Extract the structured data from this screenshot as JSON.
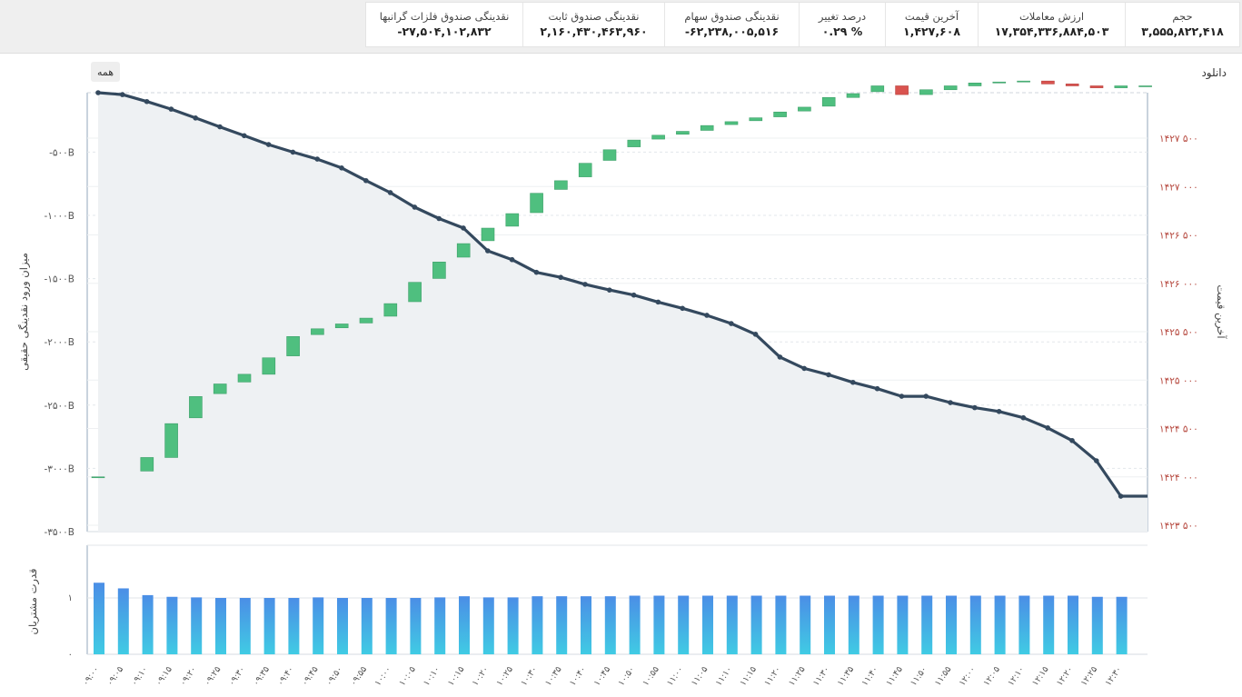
{
  "stats": [
    {
      "label": "حجم",
      "value": "۳,۵۵۵,۸۲۲,۴۱۸"
    },
    {
      "label": "ارزش معاملات",
      "value": "۱۷,۳۵۴,۳۳۶,۸۸۴,۵۰۳"
    },
    {
      "label": "آخرین قیمت",
      "value": "۱,۴۲۷,۶۰۸"
    },
    {
      "label": "درصد تغییر",
      "value": "۰.۲۹ %"
    },
    {
      "label": "نقدینگی صندوق سهام",
      "value": "-۶۲,۲۳۸,۰۰۵,۵۱۶"
    },
    {
      "label": "نقدینگی صندوق ثابت",
      "value": "۲,۱۶۰,۴۳۰,۴۶۳,۹۶۰"
    },
    {
      "label": "نقدینگی صندوق فلزات گرانبها",
      "value": "-۲۷,۵۰۴,۱۰۲,۸۳۲"
    }
  ],
  "toolbar": {
    "download_label": "دانلود",
    "all_label": "همه"
  },
  "colors": {
    "line": "#34495e",
    "area": "#eef1f3",
    "candle_up": "#4fbf7f",
    "candle_down": "#d9534f",
    "bar_top": "#4b8ee6",
    "bar_bottom": "#40cbe4",
    "right_axis_text": "#b5463c"
  },
  "chart_data": [
    {
      "type": "line",
      "ylabel": "میزان ورود نقدینگی حقیقی",
      "ytick_labels": [
        "-۵۰۰B",
        "-۱۰۰۰B",
        "-۱۵۰۰B",
        "-۲۰۰۰B",
        "-۲۵۰۰B",
        "-۳۰۰۰B",
        "-۳۵۰۰B"
      ],
      "ytick_values": [
        -500,
        -1000,
        -1500,
        -2000,
        -2500,
        -3000,
        -3500
      ],
      "ylim": [
        -3500,
        -30
      ],
      "x": [
        "۰۹:۰۰",
        "۰۹:۰۵",
        "۰۹:۱۰",
        "۰۹:۱۵",
        "۰۹:۲۰",
        "۰۹:۲۵",
        "۰۹:۳۰",
        "۰۹:۳۵",
        "۰۹:۴۰",
        "۰۹:۴۵",
        "۰۹:۵۰",
        "۰۹:۵۵",
        "۱۰:۰۰",
        "۱۰:۰۵",
        "۱۰:۱۰",
        "۱۰:۱۵",
        "۱۰:۲۰",
        "۱۰:۲۵",
        "۱۰:۳۰",
        "۱۰:۳۵",
        "۱۰:۴۰",
        "۱۰:۴۵",
        "۱۰:۵۰",
        "۱۰:۵۵",
        "۱۱:۰۰",
        "۱۱:۰۵",
        "۱۱:۱۰",
        "۱۱:۱۵",
        "۱۱:۲۰",
        "۱۱:۲۵",
        "۱۱:۳۰",
        "۱۱:۳۵",
        "۱۱:۴۰",
        "۱۱:۴۵",
        "۱۱:۵۰",
        "۱۱:۵۵",
        "۱۲:۰۰",
        "۱۲:۰۵",
        "۱۲:۱۰",
        "۱۲:۱۵",
        "۱۲:۲۰",
        "۱۲:۲۵",
        "۱۲:۳۰"
      ],
      "values": [
        -30,
        -45,
        -100,
        -160,
        -230,
        -300,
        -370,
        -440,
        -500,
        -555,
        -625,
        -725,
        -820,
        -935,
        -1025,
        -1100,
        -1280,
        -1350,
        -1450,
        -1490,
        -1545,
        -1590,
        -1630,
        -1685,
        -1735,
        -1790,
        -1855,
        -1940,
        -2120,
        -2210,
        -2260,
        -2320,
        -2370,
        -2430,
        -2430,
        -2480,
        -2520,
        -2550,
        -2600,
        -2680,
        -2780,
        -2940,
        -3220,
        -3220
      ]
    },
    {
      "type": "candlestick",
      "ylabel": "آخرین قیمت",
      "ytick_labels": [
        "۱۴۲۳ ۵۰۰",
        "۱۴۲۴ ۰۰۰",
        "۱۴۲۴ ۵۰۰",
        "۱۴۲۵ ۰۰۰",
        "۱۴۲۵ ۵۰۰",
        "۱۴۲۶ ۰۰۰",
        "۱۴۲۶ ۵۰۰",
        "۱۴۲۷ ۰۰۰",
        "۱۴۲۷ ۵۰۰"
      ],
      "ytick_values": [
        1423500,
        1424000,
        1424500,
        1425000,
        1425500,
        1426000,
        1426500,
        1427000,
        1427500
      ],
      "ylim": [
        1423500,
        1427920
      ],
      "candles": [
        {
          "open": 1424000,
          "close": 1424000
        },
        {
          "open": 1424060,
          "close": 1424200
        },
        {
          "open": 1424200,
          "close": 1424550
        },
        {
          "open": 1424610,
          "close": 1424830
        },
        {
          "open": 1424860,
          "close": 1424960
        },
        {
          "open": 1424980,
          "close": 1425060
        },
        {
          "open": 1425060,
          "close": 1425230
        },
        {
          "open": 1425250,
          "close": 1425450
        },
        {
          "open": 1425470,
          "close": 1425530
        },
        {
          "open": 1425540,
          "close": 1425580
        },
        {
          "open": 1425590,
          "close": 1425640
        },
        {
          "open": 1425660,
          "close": 1425790
        },
        {
          "open": 1425810,
          "close": 1426010
        },
        {
          "open": 1426050,
          "close": 1426220
        },
        {
          "open": 1426270,
          "close": 1426410
        },
        {
          "open": 1426440,
          "close": 1426570
        },
        {
          "open": 1426590,
          "close": 1426720
        },
        {
          "open": 1426730,
          "close": 1426930
        },
        {
          "open": 1426970,
          "close": 1427060
        },
        {
          "open": 1427100,
          "close": 1427240
        },
        {
          "open": 1427270,
          "close": 1427380
        },
        {
          "open": 1427410,
          "close": 1427480
        },
        {
          "open": 1427490,
          "close": 1427530
        },
        {
          "open": 1427540,
          "close": 1427570
        },
        {
          "open": 1427580,
          "close": 1427630
        },
        {
          "open": 1427640,
          "close": 1427670
        },
        {
          "open": 1427680,
          "close": 1427710
        },
        {
          "open": 1427720,
          "close": 1427770
        },
        {
          "open": 1427780,
          "close": 1427820
        },
        {
          "open": 1427830,
          "close": 1427920
        },
        {
          "open": 1427920,
          "close": 1427960
        },
        {
          "open": 1427980,
          "close": 1428040
        },
        {
          "open": 1428040,
          "close": 1427950
        },
        {
          "open": 1427950,
          "close": 1428000
        },
        {
          "open": 1428000,
          "close": 1428040
        },
        {
          "open": 1428040,
          "close": 1428070
        },
        {
          "open": 1428070,
          "close": 1428080
        },
        {
          "open": 1428080,
          "close": 1428090
        },
        {
          "open": 1428090,
          "close": 1428060
        },
        {
          "open": 1428060,
          "close": 1428040
        },
        {
          "open": 1428040,
          "close": 1428020
        },
        {
          "open": 1428020,
          "close": 1428040
        },
        {
          "open": 1428040,
          "close": 1428040
        }
      ]
    },
    {
      "type": "bar",
      "ylabel": "قدرت مشتریان",
      "ytick_labels": [
        "۰",
        "۱"
      ],
      "ytick_values": [
        0,
        1
      ],
      "ylim": [
        0,
        1.3
      ],
      "x": [
        "۰۹:۰۰",
        "۰۹:۰۵",
        "۰۹:۱۰",
        "۰۹:۱۵",
        "۰۹:۲۰",
        "۰۹:۲۵",
        "۰۹:۳۰",
        "۰۹:۳۵",
        "۰۹:۴۰",
        "۰۹:۴۵",
        "۰۹:۵۰",
        "۰۹:۵۵",
        "۱۰:۰۰",
        "۱۰:۰۵",
        "۱۰:۱۰",
        "۱۰:۱۵",
        "۱۰:۲۰",
        "۱۰:۲۵",
        "۱۰:۳۰",
        "۱۰:۳۵",
        "۱۰:۴۰",
        "۱۰:۴۵",
        "۱۰:۵۰",
        "۱۰:۵۵",
        "۱۱:۰۰",
        "۱۱:۰۵",
        "۱۱:۱۰",
        "۱۱:۱۵",
        "۱۱:۲۰",
        "۱۱:۲۵",
        "۱۱:۳۰",
        "۱۱:۳۵",
        "۱۱:۴۰",
        "۱۱:۴۵",
        "۱۱:۵۰",
        "۱۱:۵۵",
        "۱۲:۰۰",
        "۱۲:۰۵",
        "۱۲:۱۰",
        "۱۲:۱۵",
        "۱۲:۲۰",
        "۱۲:۲۵",
        "۱۲:۳۰"
      ],
      "values": [
        1.27,
        1.17,
        1.05,
        1.02,
        1.01,
        1.0,
        1.0,
        1.0,
        1.0,
        1.01,
        1.0,
        1.0,
        1.0,
        1.0,
        1.01,
        1.03,
        1.01,
        1.01,
        1.03,
        1.03,
        1.03,
        1.03,
        1.04,
        1.04,
        1.04,
        1.04,
        1.04,
        1.04,
        1.04,
        1.04,
        1.04,
        1.04,
        1.04,
        1.04,
        1.04,
        1.04,
        1.04,
        1.04,
        1.04,
        1.04,
        1.04,
        1.02,
        1.02
      ]
    }
  ]
}
